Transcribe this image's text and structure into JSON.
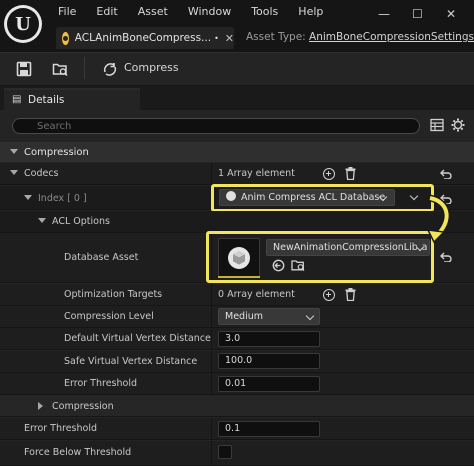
{
  "menu": [
    "File",
    "Edit",
    "Asset",
    "Window",
    "Tools",
    "Help"
  ],
  "window_controls": {
    "minimize": "—",
    "maximize": "☐",
    "close": "✕"
  },
  "document_tab": {
    "title": "ACLAnimBoneCompress...",
    "modified": "•",
    "close": "✕"
  },
  "asset_type": {
    "label": "Asset Type:",
    "value": "AnimBoneCompressionSettings"
  },
  "toolbar": {
    "compress_label": "Compress"
  },
  "details": {
    "tab_label": "Details",
    "search_placeholder": "Search",
    "compression_category": "Compression",
    "codecs": {
      "label": "Codecs",
      "value": "1 Array element"
    },
    "index": {
      "label": "Index [ 0 ]",
      "value": "Anim Compress ACL Database"
    },
    "acl_options": "ACL Options",
    "database_asset": {
      "label": "Database Asset",
      "value": "NewAnimationCompressionLibra"
    },
    "optimization_targets": {
      "label": "Optimization Targets",
      "value": "0 Array element"
    },
    "compression_level": {
      "label": "Compression Level",
      "value": "Medium"
    },
    "default_vvd": {
      "label": "Default Virtual Vertex Distance",
      "value": "3.0"
    },
    "safe_vvd": {
      "label": "Safe Virtual Vertex Distance",
      "value": "100.0"
    },
    "error_threshold_inner": {
      "label": "Error Threshold",
      "value": "0.01"
    },
    "compression_sub": "Compression",
    "error_threshold": {
      "label": "Error Threshold",
      "value": "0.1"
    },
    "force_below_threshold": {
      "label": "Force Below Threshold"
    }
  },
  "colors": {
    "highlight": "#f2e55a",
    "accent": "#f0c040"
  }
}
